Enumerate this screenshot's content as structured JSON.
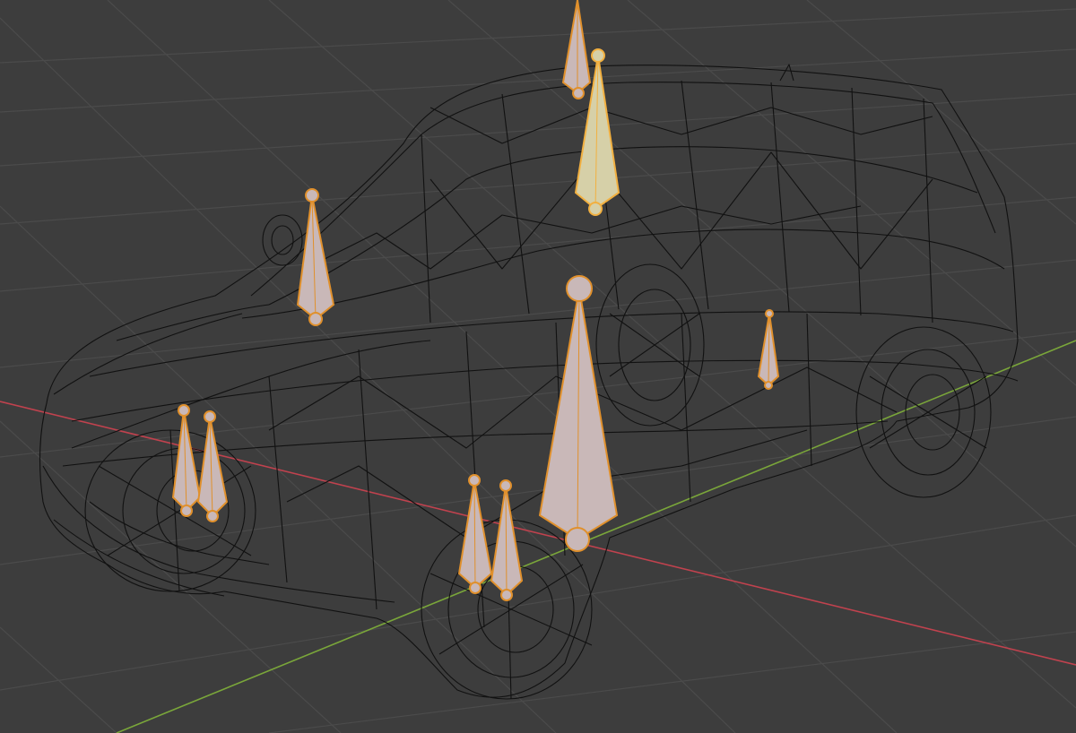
{
  "viewport": {
    "mode": "wireframe",
    "object": "car-mesh",
    "armature": "bone-chain"
  },
  "colors": {
    "background": "#3d3d3d",
    "grid_line": "#4a4a4a",
    "axis_x": "#c0424e",
    "axis_y": "#7aa63a",
    "wire": "#111111",
    "bone_fill": "#c9b8b8",
    "bone_fill_active": "#d6d0a8",
    "bone_outline": "#e0902c",
    "bone_outline_active": "#f2b040"
  },
  "icons": {
    "bone": "octahedral-bone-shape",
    "joint": "circle-joint"
  }
}
